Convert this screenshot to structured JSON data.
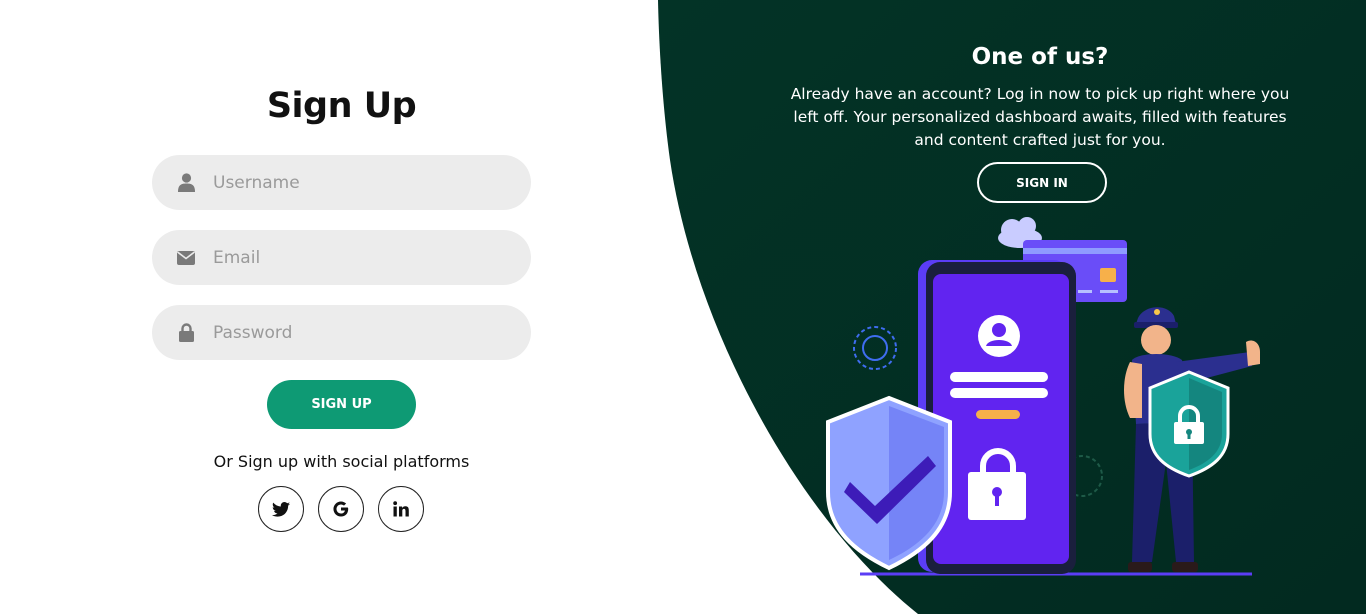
{
  "signup": {
    "title": "Sign Up",
    "username_placeholder": "Username",
    "email_placeholder": "Email",
    "password_placeholder": "Password",
    "submit_label": "SIGN UP",
    "social_text": "Or Sign up with social platforms",
    "social_icons": [
      "twitter-icon",
      "google-icon",
      "linkedin-icon"
    ]
  },
  "panel": {
    "title": "One of us?",
    "text": "Already have an account? Log in now to pick up right where you left off. Your personalized dashboard awaits, filled with features and content crafted just for you.",
    "button_label": "SIGN IN"
  },
  "colors": {
    "panel_bg": "#03382a",
    "accent": "#0e9a74",
    "input_bg": "#ececec"
  }
}
